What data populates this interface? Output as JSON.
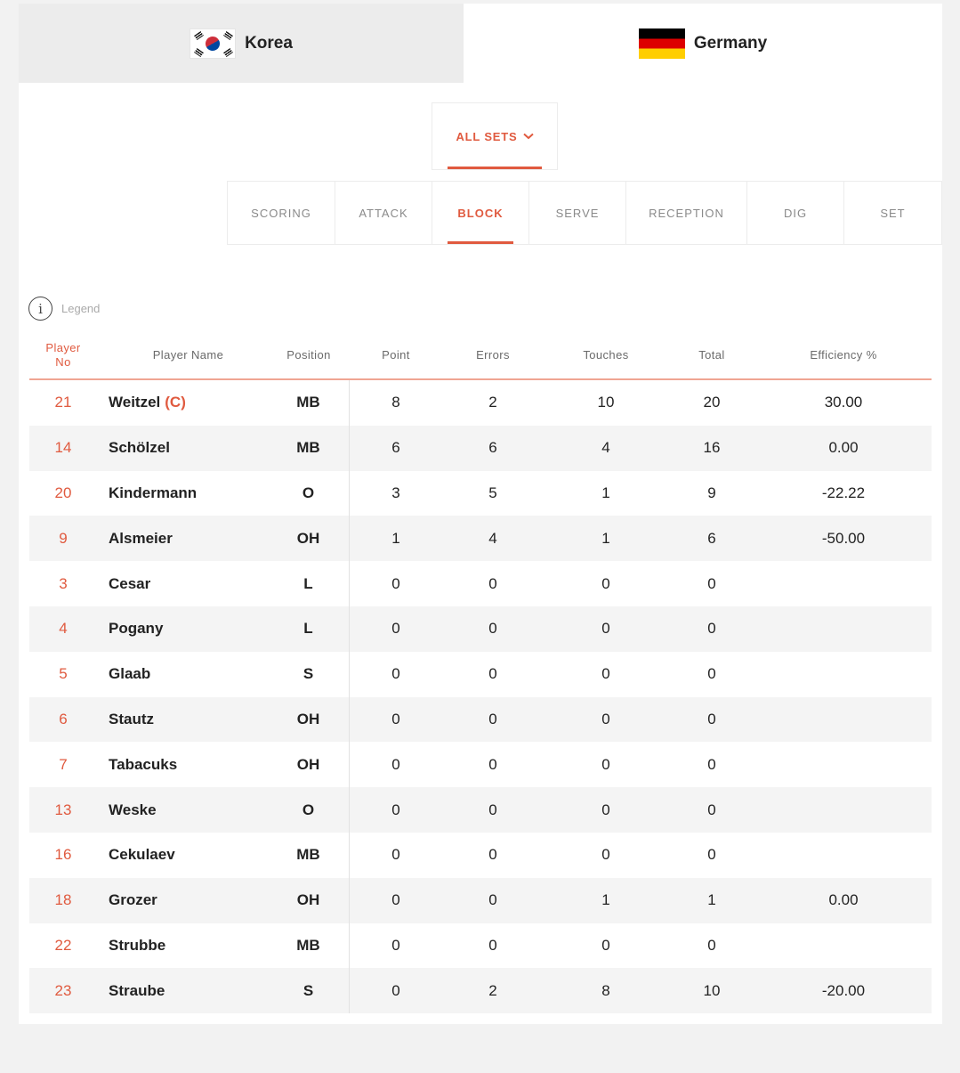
{
  "teams": [
    {
      "name": "Korea",
      "flag": "korea-flag",
      "active": false
    },
    {
      "name": "Germany",
      "flag": "germany-flag",
      "active": true
    }
  ],
  "sets_filter": {
    "label": "ALL SETS"
  },
  "stat_tabs": [
    "SCORING",
    "ATTACK",
    "BLOCK",
    "SERVE",
    "RECEPTION",
    "DIG",
    "SET"
  ],
  "active_stat_tab": "BLOCK",
  "legend": {
    "label": "Legend"
  },
  "table": {
    "headers": {
      "no": "Player No",
      "name": "Player Name",
      "position": "Position",
      "point": "Point",
      "errors": "Errors",
      "touches": "Touches",
      "total": "Total",
      "efficiency": "Efficiency %"
    },
    "rows": [
      {
        "no": "21",
        "name": "Weitzel",
        "captain": "(C)",
        "position": "MB",
        "point": "8",
        "errors": "2",
        "touches": "10",
        "total": "20",
        "efficiency": "30.00"
      },
      {
        "no": "14",
        "name": "Schölzel",
        "captain": "",
        "position": "MB",
        "point": "6",
        "errors": "6",
        "touches": "4",
        "total": "16",
        "efficiency": "0.00"
      },
      {
        "no": "20",
        "name": "Kindermann",
        "captain": "",
        "position": "O",
        "point": "3",
        "errors": "5",
        "touches": "1",
        "total": "9",
        "efficiency": "-22.22"
      },
      {
        "no": "9",
        "name": "Alsmeier",
        "captain": "",
        "position": "OH",
        "point": "1",
        "errors": "4",
        "touches": "1",
        "total": "6",
        "efficiency": "-50.00"
      },
      {
        "no": "3",
        "name": "Cesar",
        "captain": "",
        "position": "L",
        "point": "0",
        "errors": "0",
        "touches": "0",
        "total": "0",
        "efficiency": ""
      },
      {
        "no": "4",
        "name": "Pogany",
        "captain": "",
        "position": "L",
        "point": "0",
        "errors": "0",
        "touches": "0",
        "total": "0",
        "efficiency": ""
      },
      {
        "no": "5",
        "name": "Glaab",
        "captain": "",
        "position": "S",
        "point": "0",
        "errors": "0",
        "touches": "0",
        "total": "0",
        "efficiency": ""
      },
      {
        "no": "6",
        "name": "Stautz",
        "captain": "",
        "position": "OH",
        "point": "0",
        "errors": "0",
        "touches": "0",
        "total": "0",
        "efficiency": ""
      },
      {
        "no": "7",
        "name": "Tabacuks",
        "captain": "",
        "position": "OH",
        "point": "0",
        "errors": "0",
        "touches": "0",
        "total": "0",
        "efficiency": ""
      },
      {
        "no": "13",
        "name": "Weske",
        "captain": "",
        "position": "O",
        "point": "0",
        "errors": "0",
        "touches": "0",
        "total": "0",
        "efficiency": ""
      },
      {
        "no": "16",
        "name": "Cekulaev",
        "captain": "",
        "position": "MB",
        "point": "0",
        "errors": "0",
        "touches": "0",
        "total": "0",
        "efficiency": ""
      },
      {
        "no": "18",
        "name": "Grozer",
        "captain": "",
        "position": "OH",
        "point": "0",
        "errors": "0",
        "touches": "1",
        "total": "1",
        "efficiency": "0.00"
      },
      {
        "no": "22",
        "name": "Strubbe",
        "captain": "",
        "position": "MB",
        "point": "0",
        "errors": "0",
        "touches": "0",
        "total": "0",
        "efficiency": ""
      },
      {
        "no": "23",
        "name": "Straube",
        "captain": "",
        "position": "S",
        "point": "0",
        "errors": "2",
        "touches": "8",
        "total": "10",
        "efficiency": "-20.00"
      }
    ]
  },
  "colors": {
    "accent": "#e05a3f",
    "inactive_tab_bg": "#ececec",
    "row_alt_bg": "#f4f4f4"
  }
}
